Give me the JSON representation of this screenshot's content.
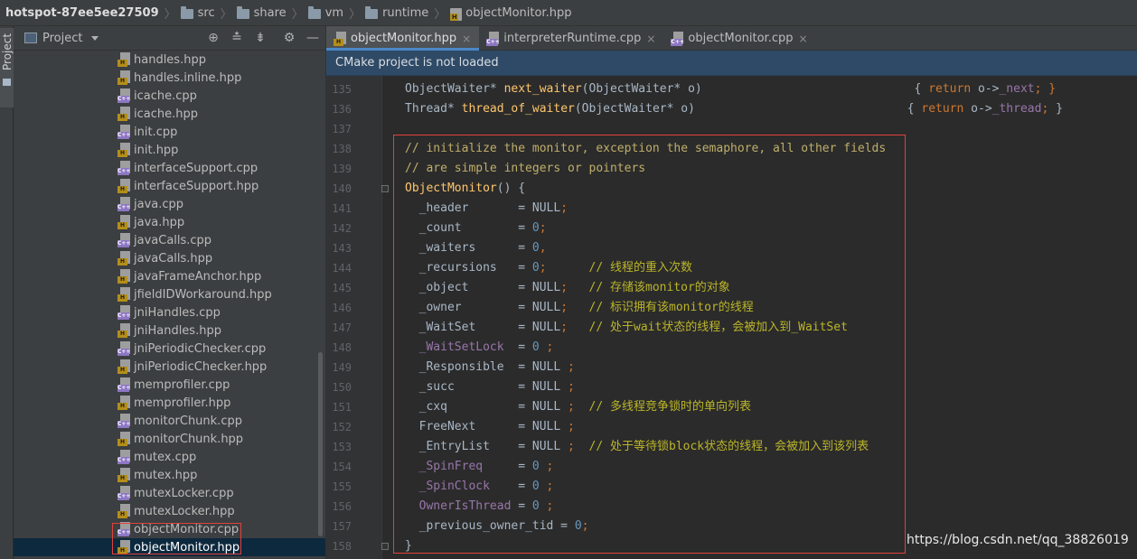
{
  "breadcrumb": {
    "root": "hotspot-87ee5ee27509",
    "items": [
      "src",
      "share",
      "vm",
      "runtime"
    ],
    "file": "objectMonitor.hpp"
  },
  "tool_strip": {
    "project_label": "Project"
  },
  "project_panel": {
    "title": "Project",
    "files": [
      {
        "name": "handles.hpp",
        "type": "h"
      },
      {
        "name": "handles.inline.hpp",
        "type": "h"
      },
      {
        "name": "icache.cpp",
        "type": "cpp"
      },
      {
        "name": "icache.hpp",
        "type": "h"
      },
      {
        "name": "init.cpp",
        "type": "cpp"
      },
      {
        "name": "init.hpp",
        "type": "h"
      },
      {
        "name": "interfaceSupport.cpp",
        "type": "cpp"
      },
      {
        "name": "interfaceSupport.hpp",
        "type": "h"
      },
      {
        "name": "java.cpp",
        "type": "cpp"
      },
      {
        "name": "java.hpp",
        "type": "h"
      },
      {
        "name": "javaCalls.cpp",
        "type": "cpp"
      },
      {
        "name": "javaCalls.hpp",
        "type": "h"
      },
      {
        "name": "javaFrameAnchor.hpp",
        "type": "h"
      },
      {
        "name": "jfieldIDWorkaround.hpp",
        "type": "h"
      },
      {
        "name": "jniHandles.cpp",
        "type": "cpp"
      },
      {
        "name": "jniHandles.hpp",
        "type": "h"
      },
      {
        "name": "jniPeriodicChecker.cpp",
        "type": "cpp"
      },
      {
        "name": "jniPeriodicChecker.hpp",
        "type": "h"
      },
      {
        "name": "memprofiler.cpp",
        "type": "cpp"
      },
      {
        "name": "memprofiler.hpp",
        "type": "h"
      },
      {
        "name": "monitorChunk.cpp",
        "type": "cpp"
      },
      {
        "name": "monitorChunk.hpp",
        "type": "h"
      },
      {
        "name": "mutex.cpp",
        "type": "cpp"
      },
      {
        "name": "mutex.hpp",
        "type": "h"
      },
      {
        "name": "mutexLocker.cpp",
        "type": "cpp"
      },
      {
        "name": "mutexLocker.hpp",
        "type": "h"
      },
      {
        "name": "objectMonitor.cpp",
        "type": "cpp"
      },
      {
        "name": "objectMonitor.hpp",
        "type": "h",
        "selected": true
      }
    ]
  },
  "tabs": [
    {
      "label": "objectMonitor.hpp",
      "type": "h",
      "active": true
    },
    {
      "label": "interpreterRuntime.cpp",
      "type": "cpp",
      "active": false
    },
    {
      "label": "objectMonitor.cpp",
      "type": "cpp",
      "active": false
    }
  ],
  "tab_close_glyph": "×",
  "notification": "CMake project is not loaded",
  "editor": {
    "line_numbers": [
      "135",
      "136",
      "137",
      "138",
      "139",
      "140",
      "141",
      "142",
      "143",
      "144",
      "145",
      "146",
      "147",
      "148",
      "149",
      "150",
      "151",
      "152",
      "153",
      "154",
      "155",
      "156",
      "157",
      "158"
    ],
    "code_lines": [
      [
        {
          "t": "ObjectWaiter* ",
          "c": "plain"
        },
        {
          "t": "next_waiter",
          "c": "fn"
        },
        {
          "t": "(ObjectWaiter* o)                              { ",
          "c": "plain"
        },
        {
          "t": "return ",
          "c": "kw"
        },
        {
          "t": "o->",
          "c": "plain"
        },
        {
          "t": "_next",
          "c": "dim"
        },
        {
          "t": "; }",
          "c": "kw"
        }
      ],
      [
        {
          "t": "Thread* ",
          "c": "plain"
        },
        {
          "t": "thread_of_waiter",
          "c": "fn"
        },
        {
          "t": "(ObjectWaiter* o)                              { ",
          "c": "plain"
        },
        {
          "t": "return ",
          "c": "kw"
        },
        {
          "t": "o->",
          "c": "plain"
        },
        {
          "t": "_thread",
          "c": "dim"
        },
        {
          "t": "; ",
          "c": "kw"
        },
        {
          "t": "}",
          "c": "plain"
        }
      ],
      [],
      [
        {
          "t": "// initialize the monitor, exception the semaphore, all other fields",
          "c": "cm-y"
        }
      ],
      [
        {
          "t": "// are simple integers or pointers",
          "c": "cm-y"
        }
      ],
      [
        {
          "t": "ObjectMonitor",
          "c": "fn"
        },
        {
          "t": "() {",
          "c": "plain"
        }
      ],
      [
        {
          "t": "  _header       = ",
          "c": "plain"
        },
        {
          "t": "NULL",
          "c": "plain"
        },
        {
          "t": ";",
          "c": "kw"
        }
      ],
      [
        {
          "t": "  _count        = ",
          "c": "plain"
        },
        {
          "t": "0",
          "c": "num"
        },
        {
          "t": ";",
          "c": "kw"
        }
      ],
      [
        {
          "t": "  _waiters      = ",
          "c": "plain"
        },
        {
          "t": "0",
          "c": "num"
        },
        {
          "t": ",",
          "c": "kw"
        }
      ],
      [
        {
          "t": "  _recursions   = ",
          "c": "plain"
        },
        {
          "t": "0",
          "c": "num"
        },
        {
          "t": ";      ",
          "c": "kw"
        },
        {
          "t": "// 线程的重入次数",
          "c": "cmt-cn"
        }
      ],
      [
        {
          "t": "  _object       = ",
          "c": "plain"
        },
        {
          "t": "NULL",
          "c": "plain"
        },
        {
          "t": ";   ",
          "c": "kw"
        },
        {
          "t": "// 存储该monitor的对象",
          "c": "cmt-cn"
        }
      ],
      [
        {
          "t": "  _owner        = ",
          "c": "plain"
        },
        {
          "t": "NULL",
          "c": "plain"
        },
        {
          "t": ";   ",
          "c": "kw"
        },
        {
          "t": "// 标识拥有该monitor的线程",
          "c": "cmt-cn"
        }
      ],
      [
        {
          "t": "  _WaitSet      = ",
          "c": "plain"
        },
        {
          "t": "NULL",
          "c": "plain"
        },
        {
          "t": ";   ",
          "c": "kw"
        },
        {
          "t": "// 处于wait状态的线程，会被加入到_WaitSet",
          "c": "cmt-cn"
        }
      ],
      [
        {
          "t": "  _WaitSetLock  ",
          "c": "dim"
        },
        {
          "t": "= ",
          "c": "plain"
        },
        {
          "t": "0",
          "c": "num"
        },
        {
          "t": " ;",
          "c": "kw"
        }
      ],
      [
        {
          "t": "  _Responsible  = ",
          "c": "plain"
        },
        {
          "t": "NULL",
          "c": "plain"
        },
        {
          "t": " ;",
          "c": "kw"
        }
      ],
      [
        {
          "t": "  _succ         = ",
          "c": "plain"
        },
        {
          "t": "NULL",
          "c": "plain"
        },
        {
          "t": " ;",
          "c": "kw"
        }
      ],
      [
        {
          "t": "  _cxq          = ",
          "c": "plain"
        },
        {
          "t": "NULL",
          "c": "plain"
        },
        {
          "t": " ;  ",
          "c": "kw"
        },
        {
          "t": "// 多线程竞争锁时的单向列表",
          "c": "cmt-cn"
        }
      ],
      [
        {
          "t": "  FreeNext      = ",
          "c": "plain"
        },
        {
          "t": "NULL",
          "c": "plain"
        },
        {
          "t": " ;",
          "c": "kw"
        }
      ],
      [
        {
          "t": "  _EntryList    = ",
          "c": "plain"
        },
        {
          "t": "NULL",
          "c": "plain"
        },
        {
          "t": " ;  ",
          "c": "kw"
        },
        {
          "t": "// 处于等待锁block状态的线程，会被加入到该列表",
          "c": "cmt-cn"
        }
      ],
      [
        {
          "t": "  _SpinFreq     ",
          "c": "dim"
        },
        {
          "t": "= ",
          "c": "plain"
        },
        {
          "t": "0",
          "c": "num"
        },
        {
          "t": " ;",
          "c": "kw"
        }
      ],
      [
        {
          "t": "  _SpinClock    ",
          "c": "dim"
        },
        {
          "t": "= ",
          "c": "plain"
        },
        {
          "t": "0",
          "c": "num"
        },
        {
          "t": " ;",
          "c": "kw"
        }
      ],
      [
        {
          "t": "  OwnerIsThread ",
          "c": "dim"
        },
        {
          "t": "= ",
          "c": "plain"
        },
        {
          "t": "0",
          "c": "num"
        },
        {
          "t": " ;",
          "c": "kw"
        }
      ],
      [
        {
          "t": "  _previous_owner_tid = ",
          "c": "plain"
        },
        {
          "t": "0",
          "c": "num"
        },
        {
          "t": ";",
          "c": "kw"
        }
      ],
      [
        {
          "t": "}",
          "c": "plain"
        }
      ]
    ]
  },
  "watermark": "https://blog.csdn.net/qq_38826019",
  "colors": {
    "accent": "#4a88c7",
    "highlight_border": "#e0413d",
    "notice_bg": "#2f4a66"
  }
}
